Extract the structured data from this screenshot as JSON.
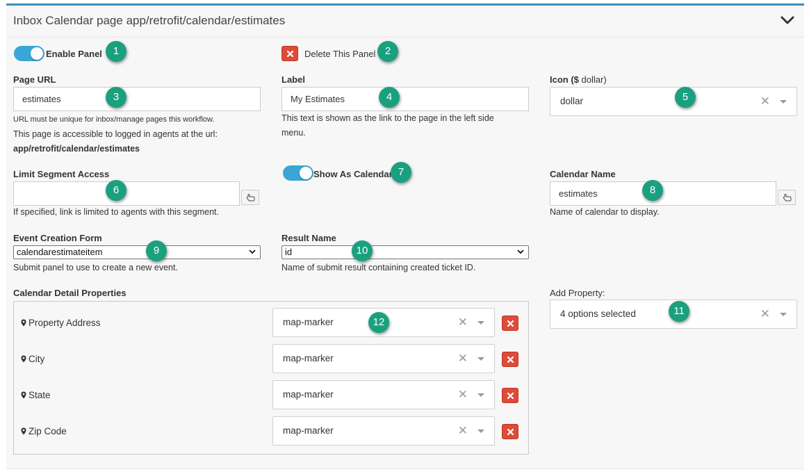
{
  "panel": {
    "title": "Inbox Calendar page app/retrofit/calendar/estimates",
    "collapse_icon": "chevron-down-icon"
  },
  "enable_panel": {
    "label": "Enable Panel",
    "on": true
  },
  "delete_panel": {
    "label": "Delete This Panel"
  },
  "page_url": {
    "label": "Page URL",
    "value": "estimates",
    "help1": "URL must be unique for inbox/manage pages this workflow.",
    "help2": "This page is accessible to logged in agents at the url:",
    "help3": "app/retrofit/calendar/estimates"
  },
  "label_field": {
    "label": "Label",
    "value": "My Estimates",
    "help1": "This text is shown as the link to the page in the left side",
    "help2": "menu."
  },
  "icon_field": {
    "label_prefix": "Icon (",
    "label_icon": "dollar-icon",
    "label_suffix": " dollar)",
    "value": "dollar"
  },
  "limit_segment": {
    "label": "Limit Segment Access",
    "value": "",
    "help": "If specified, link is limited to agents with this segment."
  },
  "show_calendar": {
    "label": "Show As Calendar",
    "on": true
  },
  "calendar_name": {
    "label": "Calendar Name",
    "value": "estimates",
    "help": "Name of calendar to display."
  },
  "event_form": {
    "label": "Event Creation Form",
    "value": "calendarestimateitem",
    "help": "Submit panel to use to create a new event."
  },
  "result_name": {
    "label": "Result Name",
    "value": "id",
    "help": "Name of submit result containing created ticket ID."
  },
  "detail_props": {
    "label": "Calendar Detail Properties",
    "rows": [
      {
        "name": "Property Address",
        "icon": "map-marker"
      },
      {
        "name": "City",
        "icon": "map-marker"
      },
      {
        "name": "State",
        "icon": "map-marker"
      },
      {
        "name": "Zip Code",
        "icon": "map-marker"
      }
    ]
  },
  "add_property": {
    "label": "Add Property:",
    "value": "4 options selected"
  },
  "callouts": [
    "1",
    "2",
    "3",
    "4",
    "5",
    "6",
    "7",
    "8",
    "9",
    "10",
    "11",
    "12"
  ],
  "colors": {
    "accent": "#3c8dbc",
    "toggle": "#3aa6d6",
    "danger": "#dd4b39",
    "callout": "#1aa07f"
  }
}
